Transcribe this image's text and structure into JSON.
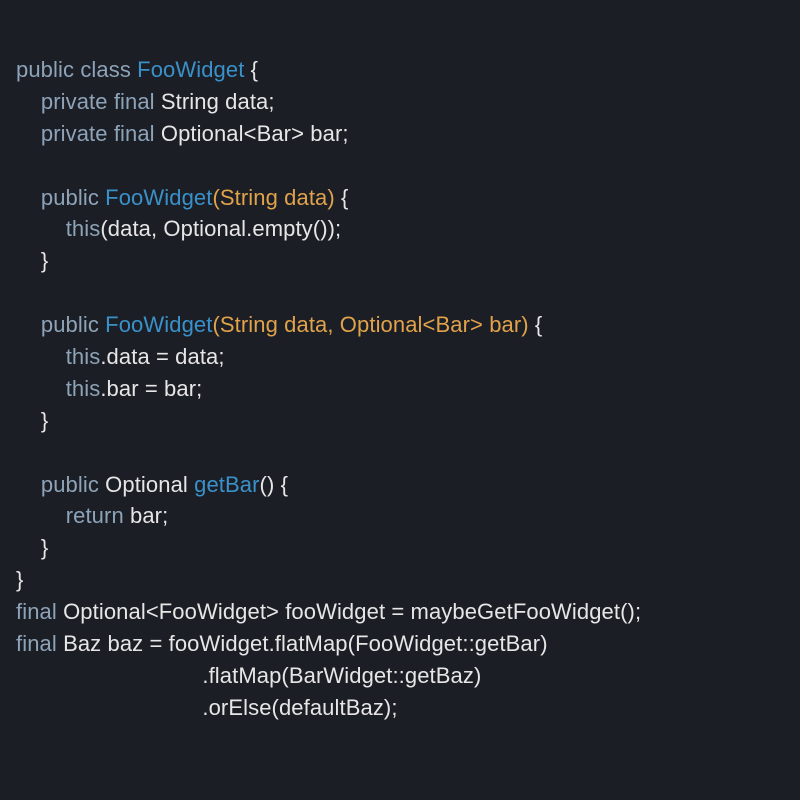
{
  "colors": {
    "background": "#1c1e26",
    "plain": "#e6e6e6",
    "keyword": "#8da3b8",
    "type": "#3a91c9",
    "signature": "#e0a24a"
  },
  "tokens": [
    [
      {
        "c": "kw",
        "t": "public"
      },
      {
        "c": "pl",
        "t": " "
      },
      {
        "c": "kw",
        "t": "class"
      },
      {
        "c": "pl",
        "t": " "
      },
      {
        "c": "type",
        "t": "FooWidget"
      },
      {
        "c": "pl",
        "t": " {"
      }
    ],
    [
      {
        "c": "pl",
        "t": "    "
      },
      {
        "c": "kw",
        "t": "private"
      },
      {
        "c": "pl",
        "t": " "
      },
      {
        "c": "kw",
        "t": "final"
      },
      {
        "c": "pl",
        "t": " String data;"
      }
    ],
    [
      {
        "c": "pl",
        "t": "    "
      },
      {
        "c": "kw",
        "t": "private"
      },
      {
        "c": "pl",
        "t": " "
      },
      {
        "c": "kw",
        "t": "final"
      },
      {
        "c": "pl",
        "t": " Optional<Bar> bar;"
      }
    ],
    [
      {
        "c": "pl",
        "t": ""
      }
    ],
    [
      {
        "c": "pl",
        "t": "    "
      },
      {
        "c": "kw",
        "t": "public"
      },
      {
        "c": "pl",
        "t": " "
      },
      {
        "c": "type",
        "t": "FooWidget"
      },
      {
        "c": "fn",
        "t": "(String data)"
      },
      {
        "c": "pl",
        "t": " {"
      }
    ],
    [
      {
        "c": "pl",
        "t": "        "
      },
      {
        "c": "kw",
        "t": "this"
      },
      {
        "c": "pl",
        "t": "(data, Optional.empty());"
      }
    ],
    [
      {
        "c": "pl",
        "t": "    }"
      }
    ],
    [
      {
        "c": "pl",
        "t": ""
      }
    ],
    [
      {
        "c": "pl",
        "t": "    "
      },
      {
        "c": "kw",
        "t": "public"
      },
      {
        "c": "pl",
        "t": " "
      },
      {
        "c": "type",
        "t": "FooWidget"
      },
      {
        "c": "fn",
        "t": "(String data, Optional<Bar> bar)"
      },
      {
        "c": "pl",
        "t": " {"
      }
    ],
    [
      {
        "c": "pl",
        "t": "        "
      },
      {
        "c": "kw",
        "t": "this"
      },
      {
        "c": "pl",
        "t": ".data = data;"
      }
    ],
    [
      {
        "c": "pl",
        "t": "        "
      },
      {
        "c": "kw",
        "t": "this"
      },
      {
        "c": "pl",
        "t": ".bar = bar;"
      }
    ],
    [
      {
        "c": "pl",
        "t": "    }"
      }
    ],
    [
      {
        "c": "pl",
        "t": ""
      }
    ],
    [
      {
        "c": "pl",
        "t": "    "
      },
      {
        "c": "kw",
        "t": "public"
      },
      {
        "c": "pl",
        "t": " Optional "
      },
      {
        "c": "type",
        "t": "getBar"
      },
      {
        "c": "pl",
        "t": "() {"
      }
    ],
    [
      {
        "c": "pl",
        "t": "        "
      },
      {
        "c": "kw",
        "t": "return"
      },
      {
        "c": "pl",
        "t": " bar;"
      }
    ],
    [
      {
        "c": "pl",
        "t": "    }"
      }
    ],
    [
      {
        "c": "pl",
        "t": "}"
      }
    ],
    [
      {
        "c": "kw",
        "t": "final"
      },
      {
        "c": "pl",
        "t": " Optional<FooWidget> fooWidget = maybeGetFooWidget();"
      }
    ],
    [
      {
        "c": "kw",
        "t": "final"
      },
      {
        "c": "pl",
        "t": " Baz baz = fooWidget.flatMap(FooWidget::getBar)"
      }
    ],
    [
      {
        "c": "pl",
        "t": "                              .flatMap(BarWidget::getBaz)"
      }
    ],
    [
      {
        "c": "pl",
        "t": "                              .orElse(defaultBaz);"
      }
    ]
  ]
}
